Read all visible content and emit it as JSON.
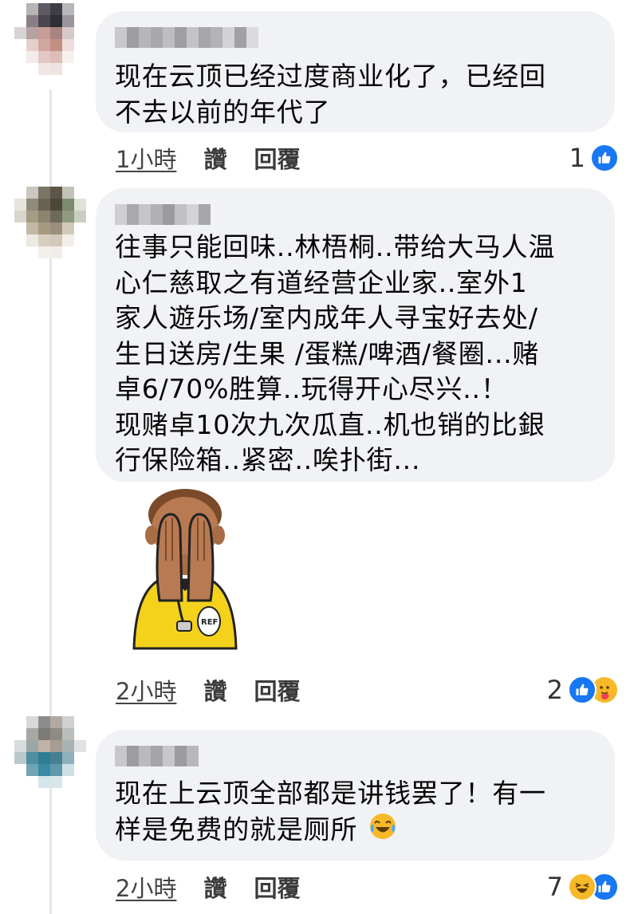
{
  "comments": [
    {
      "time": "1小時",
      "like_label": "讚",
      "reply_label": "回覆",
      "text": "现在云顶已经过度商业化了，已经回\n不去以前的年代了",
      "reaction_count": "1",
      "reactions": [
        "like-icon"
      ]
    },
    {
      "time": "2小時",
      "like_label": "讚",
      "reply_label": "回覆",
      "text": "往事只能回味..林梧桐..带给大马人温\n心仁慈取之有道经营企业家..室外1\n家人遊乐场/室内成年人寻宝好去处/\n生日送房/生果 /蛋糕/啤酒/餐圈...赌\n卓6/70%胜算..玩得开心尽兴..！\n现赌卓10次九次瓜直..机也销的比銀\n行保险箱..紧密..唉扑街...",
      "reaction_count": "2",
      "reactions": [
        "like-icon",
        "care-icon"
      ],
      "sticker": "referee-facepalm-sticker"
    },
    {
      "time": "2小時",
      "like_label": "讚",
      "reply_label": "回覆",
      "text": "现在上云顶全部都是讲钱罢了！有一\n样是免费的就是厕所",
      "reaction_count": "7",
      "reactions": [
        "haha-icon",
        "like-icon"
      ],
      "inline_emoji": "tears-of-joy-icon"
    }
  ],
  "sticker_text": "REF",
  "colors": {
    "bubble": "#f0f2f5",
    "like": "#1877f2",
    "emoji": "#f7b928",
    "text": "#050505"
  }
}
